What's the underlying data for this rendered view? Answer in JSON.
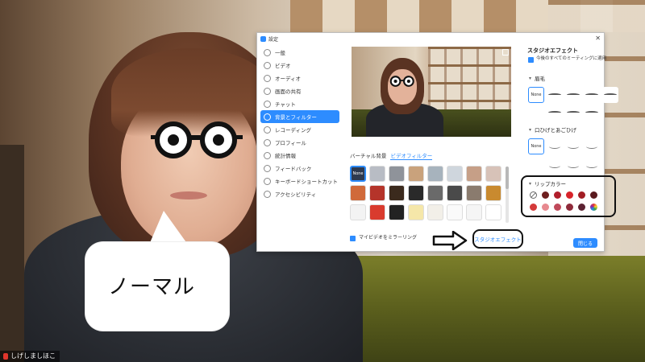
{
  "overlay": {
    "speech_bubble_text": "ノーマル",
    "participant_name": "しげしましほこ"
  },
  "window": {
    "title": "設定",
    "close_label": "✕"
  },
  "sidebar": {
    "items": [
      {
        "label": "一般",
        "icon": "gear-icon",
        "active": false
      },
      {
        "label": "ビデオ",
        "icon": "video-icon",
        "active": false
      },
      {
        "label": "オーディオ",
        "icon": "headphones-icon",
        "active": false
      },
      {
        "label": "画面の共有",
        "icon": "screen-share-icon",
        "active": false
      },
      {
        "label": "チャット",
        "icon": "chat-icon",
        "active": false
      },
      {
        "label": "背景とフィルター",
        "icon": "background-icon",
        "active": true
      },
      {
        "label": "レコーディング",
        "icon": "record-icon",
        "active": false
      },
      {
        "label": "プロフィール",
        "icon": "profile-icon",
        "active": false
      },
      {
        "label": "統計情報",
        "icon": "stats-icon",
        "active": false
      },
      {
        "label": "フィードバック",
        "icon": "feedback-icon",
        "active": false
      },
      {
        "label": "キーボードショートカット",
        "icon": "keyboard-icon",
        "active": false
      },
      {
        "label": "アクセシビリティ",
        "icon": "accessibility-icon",
        "active": false
      }
    ]
  },
  "main": {
    "tabs": [
      {
        "label": "バーチャル背景",
        "active": false
      },
      {
        "label": "ビデオフィルター",
        "active": true
      }
    ],
    "filters": [
      {
        "label": "None",
        "color": "#2e3a4f",
        "selected": true
      },
      {
        "label": "",
        "color": "#b8bcc4"
      },
      {
        "label": "",
        "color": "#8f939a"
      },
      {
        "label": "",
        "color": "#c9a27c"
      },
      {
        "label": "",
        "color": "#a7b3bd"
      },
      {
        "label": "",
        "color": "#cfd6dd"
      },
      {
        "label": "",
        "color": "#c69f87"
      },
      {
        "label": "",
        "color": "#d7c2b8"
      },
      {
        "label": "",
        "color": "#d06a3a"
      },
      {
        "label": "",
        "color": "#b5342a"
      },
      {
        "label": "",
        "color": "#3b2a1d"
      },
      {
        "label": "",
        "color": "#2a2a2a"
      },
      {
        "label": "",
        "color": "#6a6a6a"
      },
      {
        "label": "",
        "color": "#4a4a4a"
      },
      {
        "label": "",
        "color": "#8a7b6e"
      },
      {
        "label": "",
        "color": "#c98a2f"
      },
      {
        "label": "",
        "color": "#f3f3f3"
      },
      {
        "label": "",
        "color": "#d93b2e"
      },
      {
        "label": "",
        "color": "#222222"
      },
      {
        "label": "",
        "color": "#f5e7a9"
      },
      {
        "label": "",
        "color": "#f2efe8"
      },
      {
        "label": "",
        "color": "#fafafa"
      },
      {
        "label": "",
        "color": "#f5f5f5"
      },
      {
        "label": "",
        "color": "#ffffff"
      }
    ],
    "mirror_label": "マイビデオをミラーリング",
    "mirror_checked": true,
    "studio_effects_button": "スタジオエフェクト"
  },
  "studio_panel": {
    "title": "スタジオエフェクト",
    "apply_all_label": "今後のすべてのミーティングに適用",
    "eyebrows": {
      "title": "眉毛",
      "none_label": "None",
      "options": 4
    },
    "mustache": {
      "title": "口ひげとあごひげ",
      "none_label": "None",
      "options": 4
    },
    "lip_color": {
      "title": "リップカラー",
      "swatches": [
        "none",
        "#6e1f1f",
        "#b11e2b",
        "#d8232a",
        "#a21d24",
        "#5a1a1e",
        "#d43a3a",
        "#e7898f",
        "#c0495a",
        "#8f2a3a",
        "#5c2232",
        "multi"
      ]
    },
    "close_button": "閉じる"
  },
  "colors": {
    "accent": "#2d8cff",
    "annotation": "#111111"
  }
}
